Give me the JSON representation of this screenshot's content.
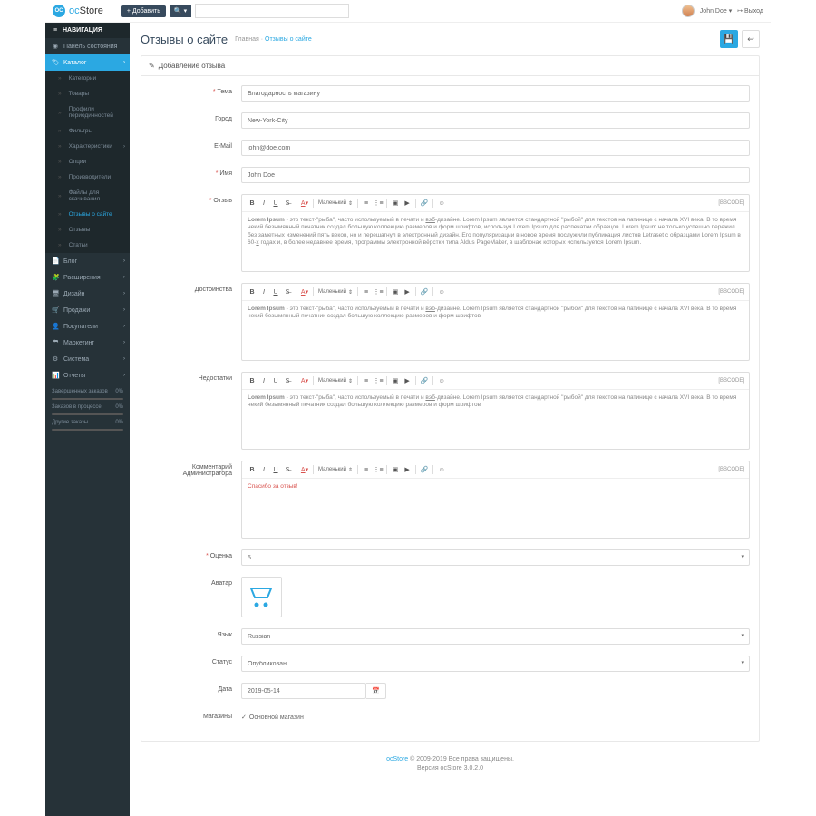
{
  "brand": {
    "short": "oc",
    "name": "Store"
  },
  "header": {
    "add": "Добавить",
    "search_placeholder": "",
    "user": "John Doe",
    "logout": "Выход"
  },
  "sidebar": {
    "title": "НАВИГАЦИЯ",
    "dashboard": "Панель состояния",
    "catalog": "Каталог",
    "catalog_items": {
      "categories": "Категории",
      "products": "Товары",
      "recurring": "Профили периодичностей",
      "filters": "Фильтры",
      "attributes": "Характеристики",
      "options": "Опции",
      "manufacturers": "Производители",
      "downloads": "Файлы для скачивания",
      "site_reviews": "Отзывы о сайте",
      "reviews": "Отзывы",
      "articles": "Статьи"
    },
    "blog": "Блог",
    "extensions": "Расширения",
    "design": "Дизайн",
    "sales": "Продажи",
    "customers": "Покупатели",
    "marketing": "Маркетинг",
    "system": "Система",
    "reports": "Отчеты",
    "stats": {
      "s1": {
        "label": "Завершенных заказов",
        "val": "0%"
      },
      "s2": {
        "label": "Заказов в процессе",
        "val": "0%"
      },
      "s3": {
        "label": "Другие заказы",
        "val": "0%"
      }
    }
  },
  "page": {
    "title": "Отзывы о сайте",
    "bc_home": "Главная",
    "bc_current": "Отзывы о сайте",
    "panel_title": "Добавление отзыва"
  },
  "labels": {
    "theme": "Тема",
    "city": "Город",
    "email": "E-Mail",
    "name": "Имя",
    "review": "Отзыв",
    "pros": "Достоинства",
    "cons": "Недостатки",
    "admin_comment": "Комментарий Администратора",
    "rating": "Оценка",
    "avatar": "Аватар",
    "language": "Язык",
    "status": "Статус",
    "date": "Дата",
    "stores": "Магазины"
  },
  "values": {
    "theme": "Благодарность магазину",
    "city": "New-York-City",
    "email": "john@doe.com",
    "name": "John Doe",
    "rating": "5",
    "language": "Russian",
    "status": "Опубликован",
    "date": "2019-05-14",
    "store": "Основной магазин"
  },
  "editor": {
    "size_label": "Маленький",
    "bbcode": "[BBCODE]",
    "review_text": "Lorem Ipsum - это текст-\"рыба\", часто используемый в печати и вэб-дизайне. Lorem Ipsum является стандартной \"рыбой\" для текстов на латинице с начала XVI века. В то время некий безымянный печатник создал большую коллекцию размеров и форм шрифтов, используя Lorem Ipsum для распечатки образцов. Lorem Ipsum не только успешно пережил без заметных изменений пять веков, но и перешагнул в электронный дизайн. Его популяризации в новое время послужили публикация листов Letraset с образцами Lorem Ipsum в 60-х годах и, в более недавнее время, программы электронной вёрстки типа Aldus PageMaker, в шаблонах которых используется Lorem Ipsum.",
    "pros_text": "Lorem Ipsum - это текст-\"рыба\", часто используемый в печати и вэб-дизайне. Lorem Ipsum является стандартной \"рыбой\" для текстов на латинице с начала XVI века. В то время некий безымянный печатник создал большую коллекцию размеров и форм шрифтов",
    "cons_text": "Lorem Ipsum - это текст-\"рыба\", часто используемый в печати и вэб-дизайне. Lorem Ipsum является стандартной \"рыбой\" для текстов на латинице с начала XVI века. В то время некий безымянный печатник создал большую коллекцию размеров и форм шрифтов",
    "admin_text": "Спасибо за отзыв!"
  },
  "footer": {
    "brand": "ocStore",
    "copy": " © 2009-2019 Все права защищены.",
    "version": "Версия ocStore 3.0.2.0"
  }
}
